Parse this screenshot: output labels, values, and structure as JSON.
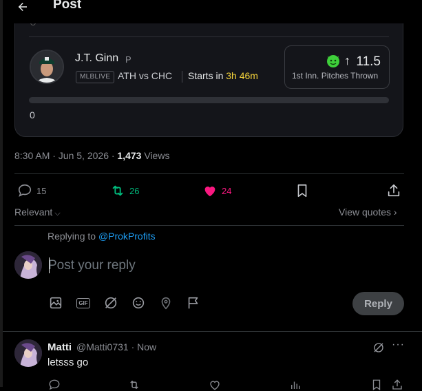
{
  "header": {
    "title": "Post"
  },
  "card": {
    "player_name": "J.T. Ginn",
    "player_position": "P",
    "league": "MLBLIVE",
    "matchup": "ATH vs CHC",
    "starts_label": "Starts in",
    "starts_time": "3h 46m",
    "stat_value": "11.5",
    "stat_label": "1st Inn. Pitches Thrown",
    "progress_value": "0",
    "colors": {
      "accent_yellow": "#f5d33b",
      "emoji_green": "#3ecf3a"
    }
  },
  "meta": {
    "time": "8:30 AM · Jun 5, 2026 · ",
    "views_count": "1,473",
    "views_label": " Views"
  },
  "actions": {
    "replies": "15",
    "reposts": "26",
    "likes": "24",
    "colors": {
      "repost": "#00ba7c",
      "like": "#f91880"
    }
  },
  "sort": {
    "label": "Relevant",
    "view_quotes": "View quotes"
  },
  "composer": {
    "replying_prefix": "Replying to ",
    "replying_handle": "@ProkProfits",
    "placeholder": "Post your reply",
    "reply_button": "Reply",
    "gif_label": "GIF"
  },
  "comment": {
    "name": "Matti",
    "handle": "@Matti0731 · Now",
    "text": "letsss go"
  }
}
